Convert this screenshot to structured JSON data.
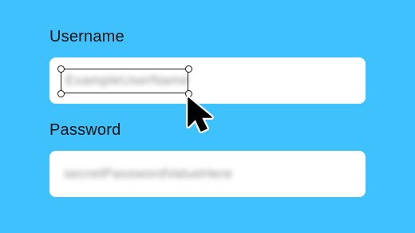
{
  "form": {
    "username": {
      "label": "Username",
      "value": "ExampleUserName"
    },
    "password": {
      "label": "Password",
      "value": "secretPasswordValueHere"
    }
  },
  "selection": {
    "icon": "selection-handles",
    "target": "username-value"
  },
  "cursor": {
    "icon": "arrow-pointer-icon"
  },
  "colors": {
    "background": "#3FC1FD",
    "field": "#FFFFFF",
    "label_text": "#111111",
    "outline": "#1A1A1A"
  }
}
